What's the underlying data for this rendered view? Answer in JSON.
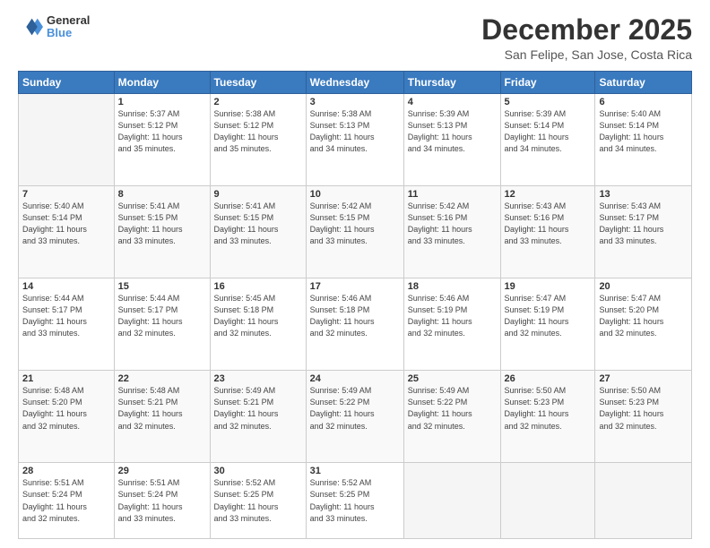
{
  "header": {
    "logo": {
      "line1": "General",
      "line2": "Blue"
    },
    "title": "December 2025",
    "subtitle": "San Felipe, San Jose, Costa Rica"
  },
  "calendar": {
    "days_of_week": [
      "Sunday",
      "Monday",
      "Tuesday",
      "Wednesday",
      "Thursday",
      "Friday",
      "Saturday"
    ],
    "weeks": [
      [
        {
          "day": "",
          "text": ""
        },
        {
          "day": "1",
          "text": "Sunrise: 5:37 AM\nSunset: 5:12 PM\nDaylight: 11 hours\nand 35 minutes."
        },
        {
          "day": "2",
          "text": "Sunrise: 5:38 AM\nSunset: 5:12 PM\nDaylight: 11 hours\nand 35 minutes."
        },
        {
          "day": "3",
          "text": "Sunrise: 5:38 AM\nSunset: 5:13 PM\nDaylight: 11 hours\nand 34 minutes."
        },
        {
          "day": "4",
          "text": "Sunrise: 5:39 AM\nSunset: 5:13 PM\nDaylight: 11 hours\nand 34 minutes."
        },
        {
          "day": "5",
          "text": "Sunrise: 5:39 AM\nSunset: 5:14 PM\nDaylight: 11 hours\nand 34 minutes."
        },
        {
          "day": "6",
          "text": "Sunrise: 5:40 AM\nSunset: 5:14 PM\nDaylight: 11 hours\nand 34 minutes."
        }
      ],
      [
        {
          "day": "7",
          "text": "Sunrise: 5:40 AM\nSunset: 5:14 PM\nDaylight: 11 hours\nand 33 minutes."
        },
        {
          "day": "8",
          "text": "Sunrise: 5:41 AM\nSunset: 5:15 PM\nDaylight: 11 hours\nand 33 minutes."
        },
        {
          "day": "9",
          "text": "Sunrise: 5:41 AM\nSunset: 5:15 PM\nDaylight: 11 hours\nand 33 minutes."
        },
        {
          "day": "10",
          "text": "Sunrise: 5:42 AM\nSunset: 5:15 PM\nDaylight: 11 hours\nand 33 minutes."
        },
        {
          "day": "11",
          "text": "Sunrise: 5:42 AM\nSunset: 5:16 PM\nDaylight: 11 hours\nand 33 minutes."
        },
        {
          "day": "12",
          "text": "Sunrise: 5:43 AM\nSunset: 5:16 PM\nDaylight: 11 hours\nand 33 minutes."
        },
        {
          "day": "13",
          "text": "Sunrise: 5:43 AM\nSunset: 5:17 PM\nDaylight: 11 hours\nand 33 minutes."
        }
      ],
      [
        {
          "day": "14",
          "text": "Sunrise: 5:44 AM\nSunset: 5:17 PM\nDaylight: 11 hours\nand 33 minutes."
        },
        {
          "day": "15",
          "text": "Sunrise: 5:44 AM\nSunset: 5:17 PM\nDaylight: 11 hours\nand 32 minutes."
        },
        {
          "day": "16",
          "text": "Sunrise: 5:45 AM\nSunset: 5:18 PM\nDaylight: 11 hours\nand 32 minutes."
        },
        {
          "day": "17",
          "text": "Sunrise: 5:46 AM\nSunset: 5:18 PM\nDaylight: 11 hours\nand 32 minutes."
        },
        {
          "day": "18",
          "text": "Sunrise: 5:46 AM\nSunset: 5:19 PM\nDaylight: 11 hours\nand 32 minutes."
        },
        {
          "day": "19",
          "text": "Sunrise: 5:47 AM\nSunset: 5:19 PM\nDaylight: 11 hours\nand 32 minutes."
        },
        {
          "day": "20",
          "text": "Sunrise: 5:47 AM\nSunset: 5:20 PM\nDaylight: 11 hours\nand 32 minutes."
        }
      ],
      [
        {
          "day": "21",
          "text": "Sunrise: 5:48 AM\nSunset: 5:20 PM\nDaylight: 11 hours\nand 32 minutes."
        },
        {
          "day": "22",
          "text": "Sunrise: 5:48 AM\nSunset: 5:21 PM\nDaylight: 11 hours\nand 32 minutes."
        },
        {
          "day": "23",
          "text": "Sunrise: 5:49 AM\nSunset: 5:21 PM\nDaylight: 11 hours\nand 32 minutes."
        },
        {
          "day": "24",
          "text": "Sunrise: 5:49 AM\nSunset: 5:22 PM\nDaylight: 11 hours\nand 32 minutes."
        },
        {
          "day": "25",
          "text": "Sunrise: 5:49 AM\nSunset: 5:22 PM\nDaylight: 11 hours\nand 32 minutes."
        },
        {
          "day": "26",
          "text": "Sunrise: 5:50 AM\nSunset: 5:23 PM\nDaylight: 11 hours\nand 32 minutes."
        },
        {
          "day": "27",
          "text": "Sunrise: 5:50 AM\nSunset: 5:23 PM\nDaylight: 11 hours\nand 32 minutes."
        }
      ],
      [
        {
          "day": "28",
          "text": "Sunrise: 5:51 AM\nSunset: 5:24 PM\nDaylight: 11 hours\nand 32 minutes."
        },
        {
          "day": "29",
          "text": "Sunrise: 5:51 AM\nSunset: 5:24 PM\nDaylight: 11 hours\nand 33 minutes."
        },
        {
          "day": "30",
          "text": "Sunrise: 5:52 AM\nSunset: 5:25 PM\nDaylight: 11 hours\nand 33 minutes."
        },
        {
          "day": "31",
          "text": "Sunrise: 5:52 AM\nSunset: 5:25 PM\nDaylight: 11 hours\nand 33 minutes."
        },
        {
          "day": "",
          "text": ""
        },
        {
          "day": "",
          "text": ""
        },
        {
          "day": "",
          "text": ""
        }
      ]
    ]
  }
}
